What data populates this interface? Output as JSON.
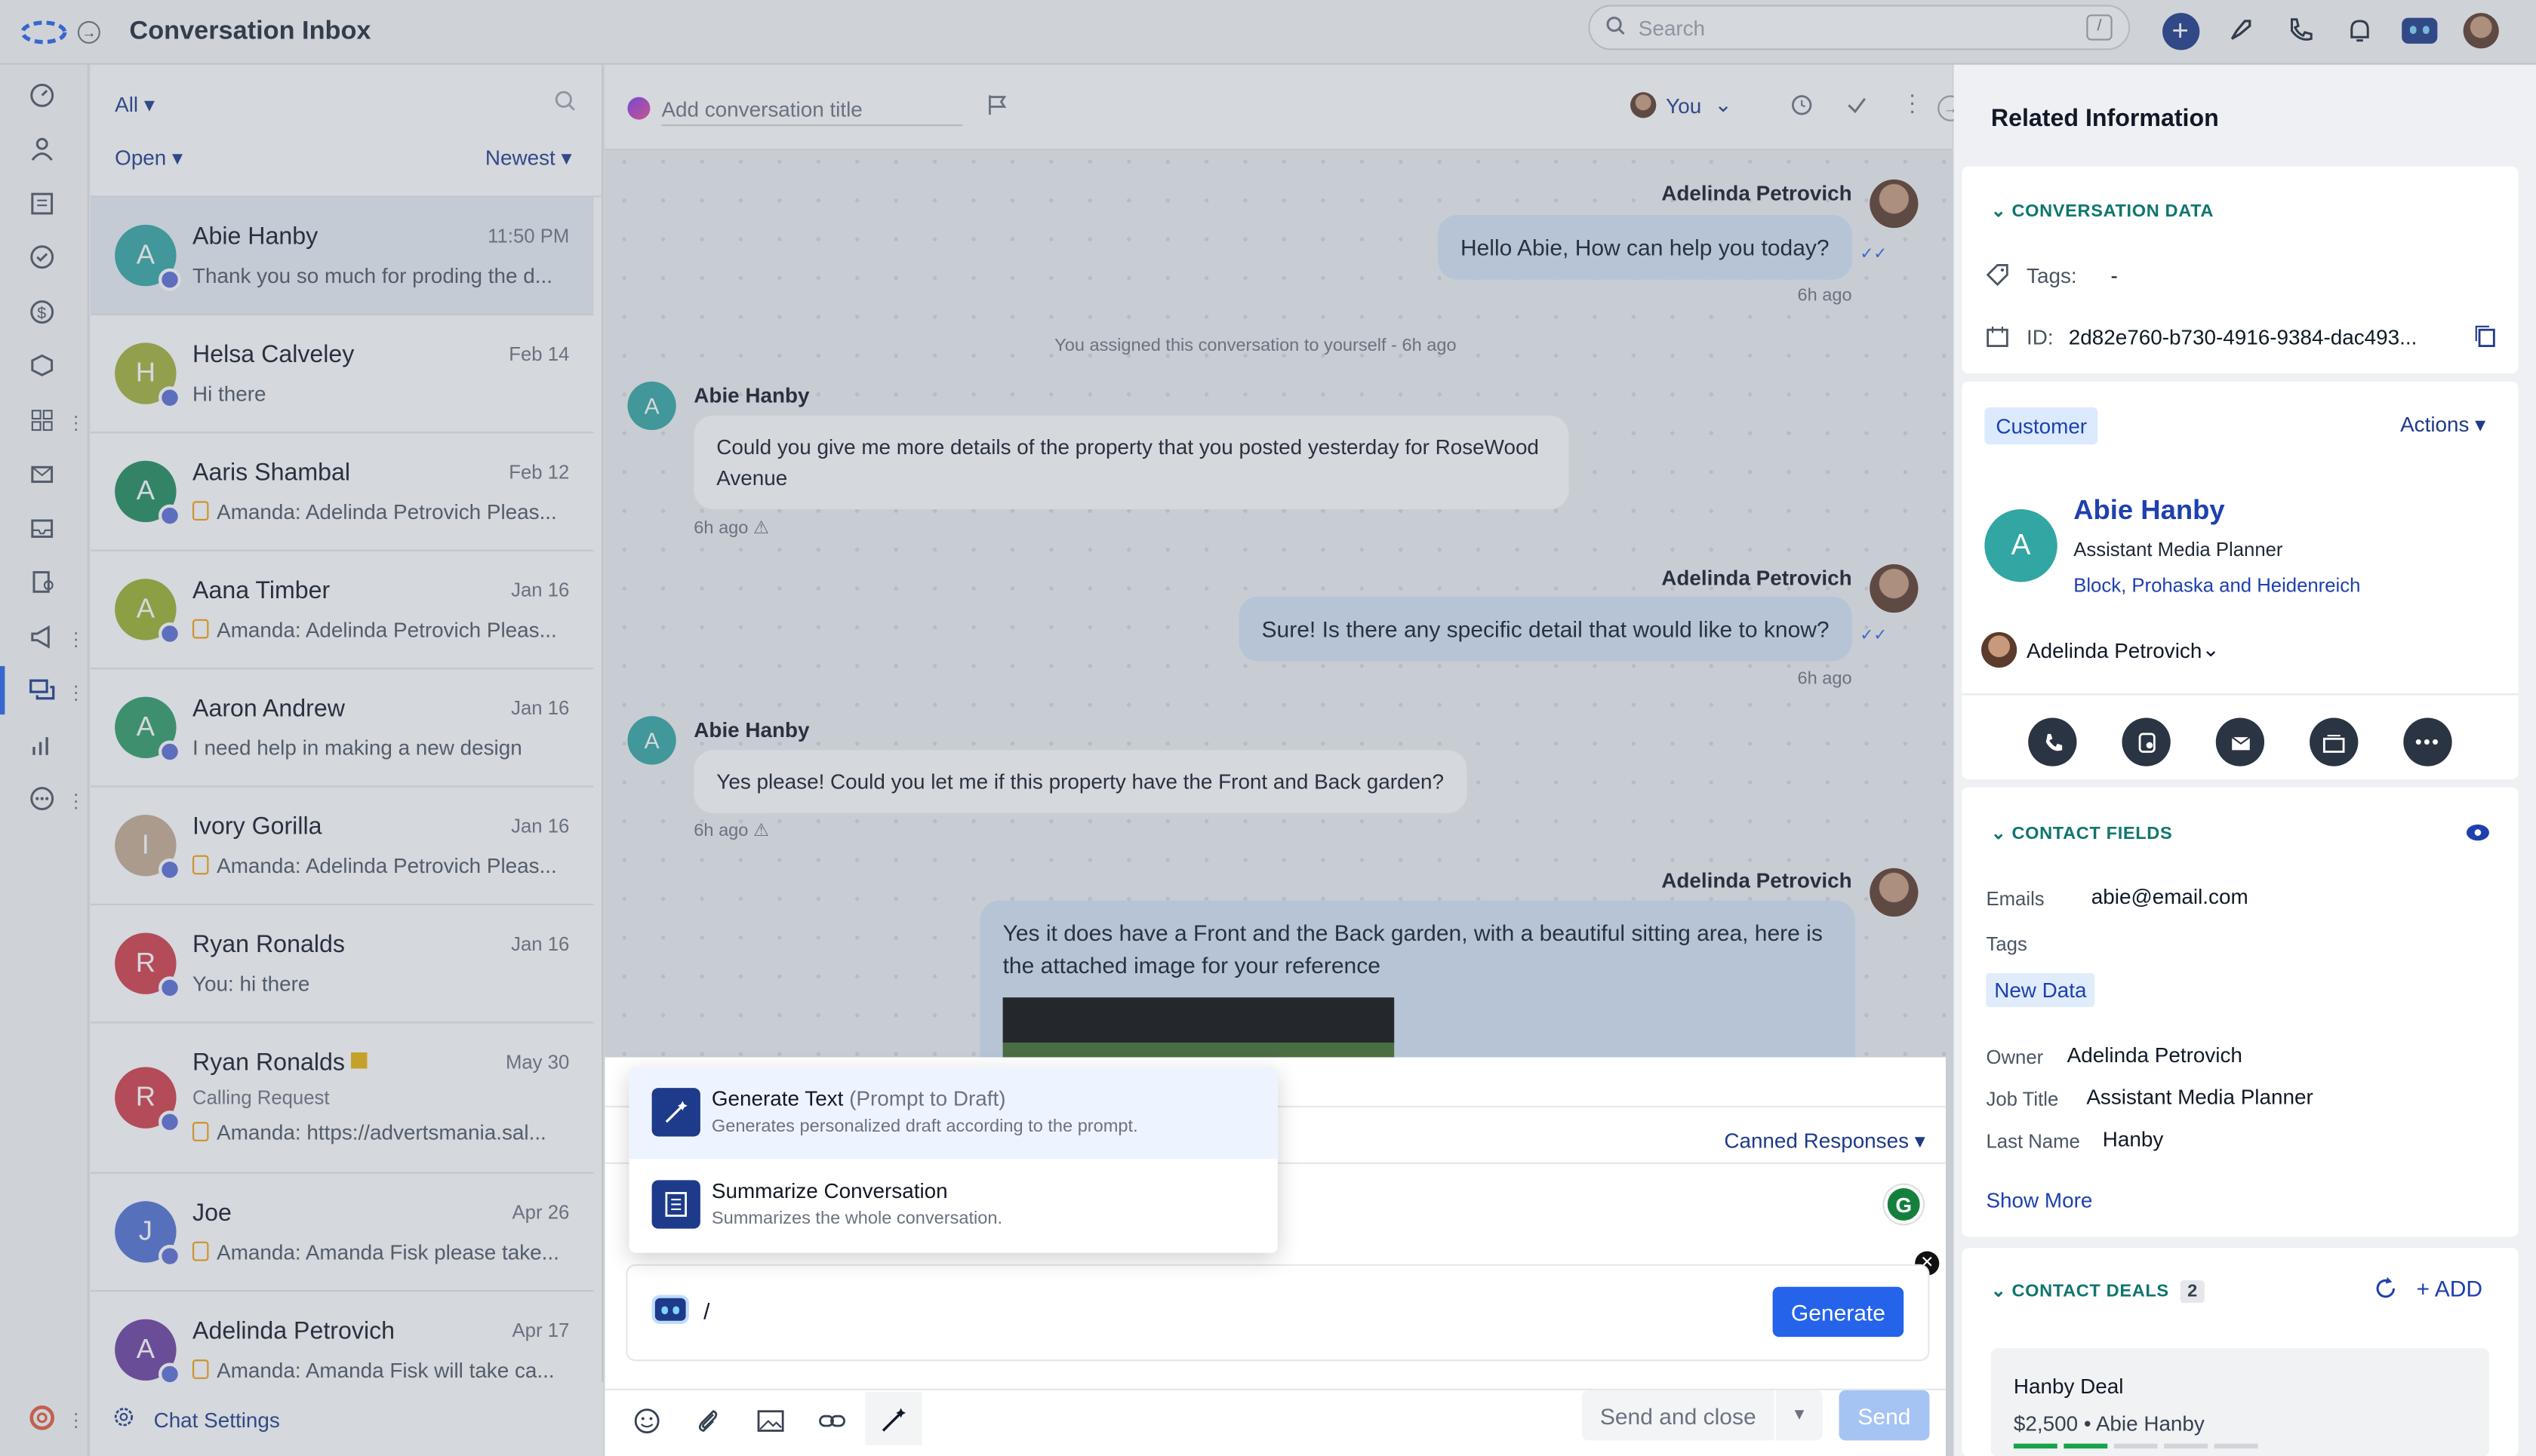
{
  "header": {
    "title": "Conversation Inbox",
    "search_placeholder": "Search",
    "search_shortcut": "/"
  },
  "colors": {
    "accent": "#2563eb",
    "brand": "#1e3a8a"
  },
  "list": {
    "filter_all": "All",
    "filter_status": "Open",
    "filter_sort": "Newest",
    "chat_settings": "Chat Settings",
    "items": [
      {
        "initial": "A",
        "name": "Abie Hanby",
        "date": "11:50 PM",
        "msg": "Thank you so much for proding the d...",
        "color": "#32a6a3"
      },
      {
        "initial": "H",
        "name": "Helsa Calveley",
        "date": "Feb 14",
        "msg": "Hi there",
        "color": "#a3b13a"
      },
      {
        "initial": "A",
        "name": "Aaris Shambal",
        "date": "Feb 12",
        "msg": "Amanda: Adelinda Petrovich Pleas...",
        "color": "#1f8b5e"
      },
      {
        "initial": "A",
        "name": "Aana Timber",
        "date": "Jan 16",
        "msg": "Amanda: Adelinda Petrovich Pleas...",
        "color": "#9ab02f"
      },
      {
        "initial": "A",
        "name": "Aaron Andrew",
        "date": "Jan 16",
        "msg": "I need help in making a new design",
        "color": "#2f9a67"
      },
      {
        "initial": "I",
        "name": "Ivory Gorilla",
        "date": "Jan 16",
        "msg": "Amanda: Adelinda Petrovich Pleas...",
        "color": "#c4ab92"
      },
      {
        "initial": "R",
        "name": "Ryan Ronalds",
        "date": "Jan 16",
        "msg": "You: hi there",
        "color": "#d13c4a"
      },
      {
        "initial": "R",
        "name": "Ryan Ronalds",
        "date": "May 30",
        "sub": "Calling Request",
        "msg": "Amanda: https://advertsmania.sal...",
        "color": "#d13c4a"
      },
      {
        "initial": "J",
        "name": "Joe",
        "date": "Apr 26",
        "msg": "Amanda: Amanda Fisk please take...",
        "color": "#4f6fd1"
      },
      {
        "initial": "A",
        "name": "Adelinda Petrovich",
        "date": "Apr 17",
        "msg": "Amanda: Amanda Fisk will take ca...",
        "color": "#6b3fa0"
      }
    ]
  },
  "chat": {
    "title_placeholder": "Add conversation title",
    "assignee": "You",
    "m1_sender": "Adelinda Petrovich",
    "m1_text": "Hello Abie, How can help you today?",
    "m1_time": "6h ago",
    "system": "You assigned this conversation to yourself - 6h ago",
    "m2_sender": "Abie Hanby",
    "m2_text": "Could you give me more details of the property that you posted yesterday for RoseWood Avenue",
    "m2_time": "6h ago",
    "m3_sender": "Adelinda Petrovich",
    "m3_text": "Sure! Is there any specific detail that would like to know?",
    "m3_time": "6h ago",
    "m4_sender": "Abie Hanby",
    "m4_text": "Yes please! Could you let me if this property have the Front and Back garden?",
    "m4_time": "6h ago",
    "m5_sender": "Adelinda Petrovich",
    "m5_text": "Yes it does have a Front and the Back garden, with a beautiful sitting area, here is the attached image for your reference"
  },
  "composer": {
    "canned": "Canned Responses",
    "ai_input": "/",
    "generate": "Generate",
    "send_close": "Send and close",
    "send": "Send",
    "popup": [
      {
        "title": "Generate Text",
        "hint": "(Prompt to Draft)",
        "desc": "Generates personalized draft according to the prompt."
      },
      {
        "title": "Summarize Conversation",
        "hint": "",
        "desc": "Summarizes the whole conversation."
      }
    ]
  },
  "right": {
    "title": "Related Information",
    "conv_data": "CONVERSATION DATA",
    "tags_label": "Tags:",
    "tags_value": "-",
    "id_label": "ID:",
    "id_value": "2d82e760-b730-4916-9384-dac493...",
    "customer_badge": "Customer",
    "actions": "Actions",
    "contact_name": "Abie Hanby",
    "contact_initial": "A",
    "contact_title": "Assistant Media Planner",
    "contact_company": "Block, Prohaska and Heidenreich",
    "owner_select": "Adelinda Petrovich",
    "contact_fields": "CONTACT FIELDS",
    "emails_label": "Emails",
    "emails_value": "abie@email.com",
    "tags2_label": "Tags",
    "tags2_value": "New Data",
    "owner_label": "Owner",
    "owner_value": "Adelinda Petrovich",
    "job_label": "Job Title",
    "job_value": "Assistant Media Planner",
    "last_label": "Last Name",
    "last_value": "Hanby",
    "show_more": "Show More",
    "deals": "CONTACT DEALS",
    "deals_count": "2",
    "add": "ADD",
    "deal_name": "Hanby Deal",
    "deal_amount": "$2,500",
    "deal_owner": "Abie Hanby"
  }
}
